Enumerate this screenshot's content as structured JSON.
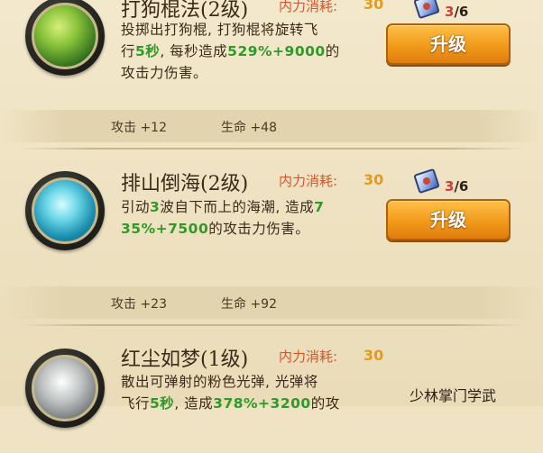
{
  "skills": [
    {
      "name": "打狗棍法(2级)",
      "cost_label": "内力消耗:",
      "cost_value": "30",
      "desc_parts": [
        "投掷出打狗棍, 打狗棍将旋转飞",
        "行",
        "5秒",
        ", 每秒造成",
        "529%+9000",
        "的",
        "攻击力伤害。"
      ],
      "count_num": "3",
      "count_den": "/6",
      "upgrade_label": "升级",
      "stats": {
        "attack": "攻击 +12",
        "life": "生命 +48"
      }
    },
    {
      "name": "排山倒海(2级)",
      "cost_label": "内力消耗:",
      "cost_value": "30",
      "desc_parts": [
        "引动",
        "3",
        "波自下而上的海潮, 造成",
        "7",
        "35%+7500",
        "的攻击力伤害。"
      ],
      "count_num": "3",
      "count_den": "/6",
      "upgrade_label": "升级",
      "stats": {
        "attack": "攻击 +23",
        "life": "生命 +92"
      }
    },
    {
      "name": "红尘如梦(1级)",
      "cost_label": "内力消耗:",
      "cost_value": "30",
      "desc_parts": [
        "散出可弹射的粉色光弹, 光弹将",
        "飞行",
        "5秒",
        ", 造成",
        "378%+3200",
        "的攻"
      ],
      "side_text": "少林掌门学武"
    }
  ],
  "colors": {
    "highlight": "#2f9a28",
    "cost_label": "#d7562b",
    "cost_value": "#e39a1d",
    "button": "#f19a1a"
  },
  "icons": [
    "staff-skill-icon",
    "wave-skill-icon",
    "orb-skill-icon",
    "skill-scroll-icon"
  ]
}
